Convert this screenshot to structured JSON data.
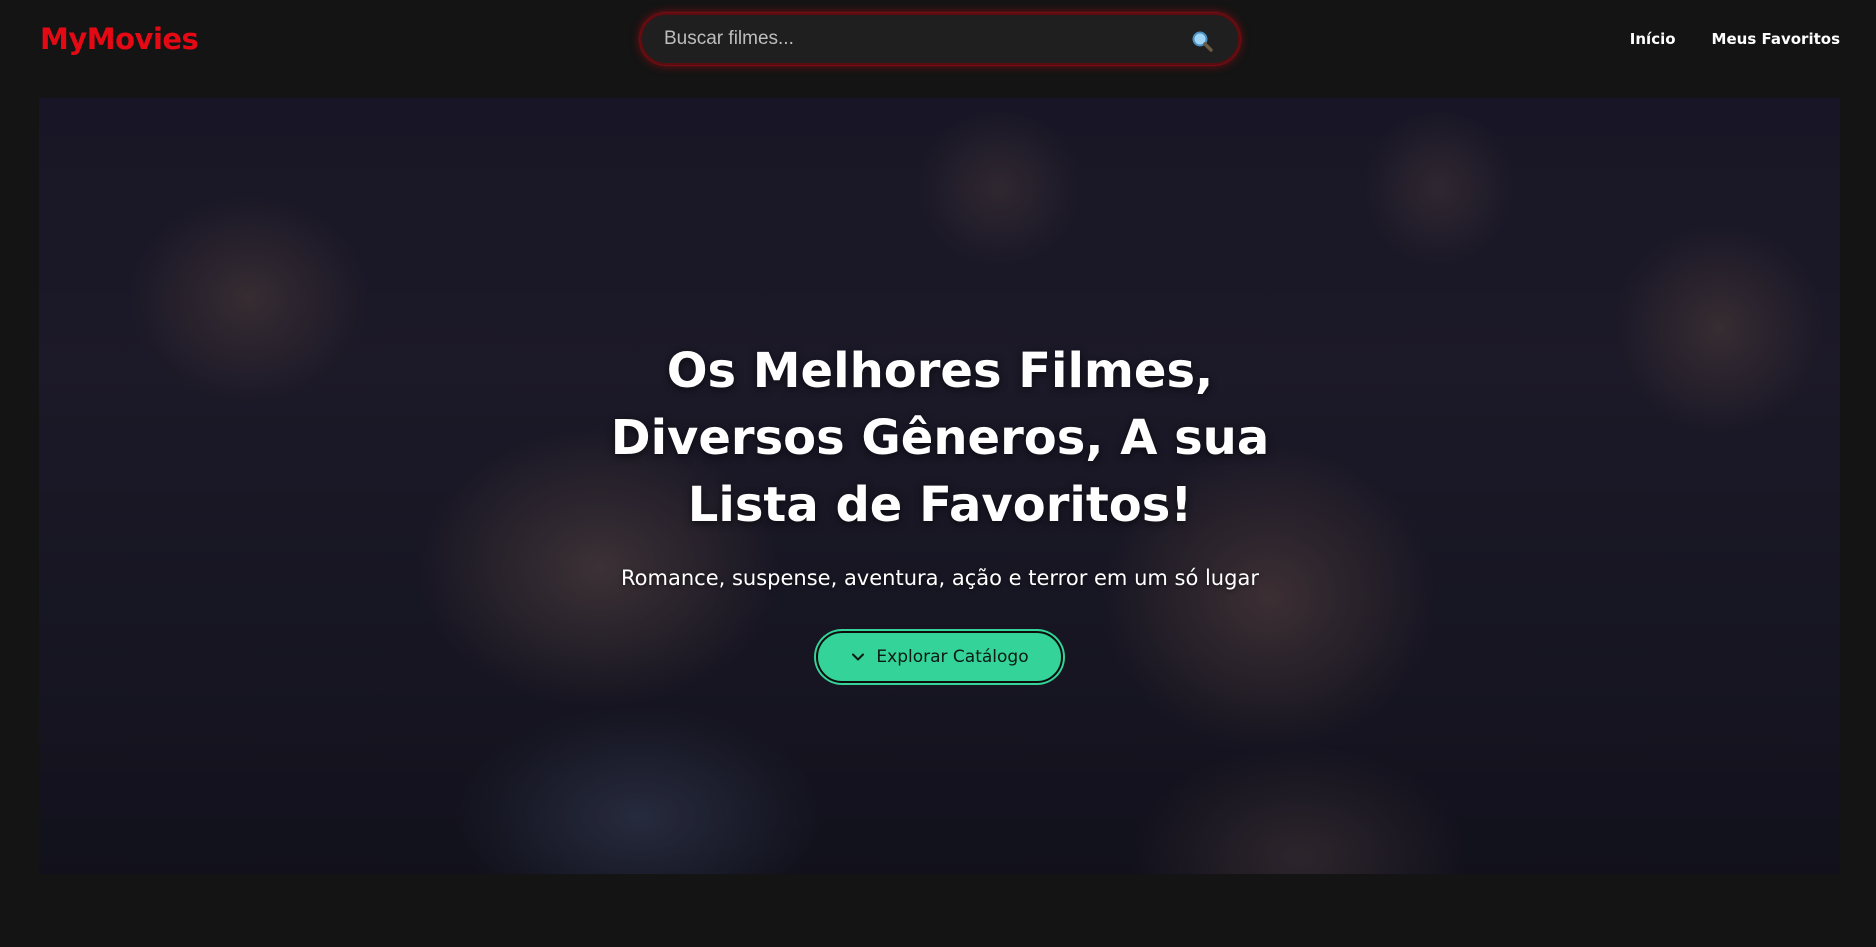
{
  "header": {
    "logo": "MyMovies",
    "search": {
      "placeholder": "Buscar filmes...",
      "value": "",
      "icon": "search-icon"
    },
    "nav": [
      {
        "label": "Início"
      },
      {
        "label": "Meus Favoritos"
      }
    ]
  },
  "hero": {
    "title": "Os Melhores Filmes, Diversos Gêneros, A sua Lista de Favoritos!",
    "subtitle": "Romance, suspense, aventura, ação e terror em um só lugar",
    "cta": {
      "label": "Explorar Catálogo",
      "icon": "chevron-down-icon"
    }
  },
  "colors": {
    "brand": "#e50914",
    "accent": "#34d399",
    "background": "#141414"
  }
}
